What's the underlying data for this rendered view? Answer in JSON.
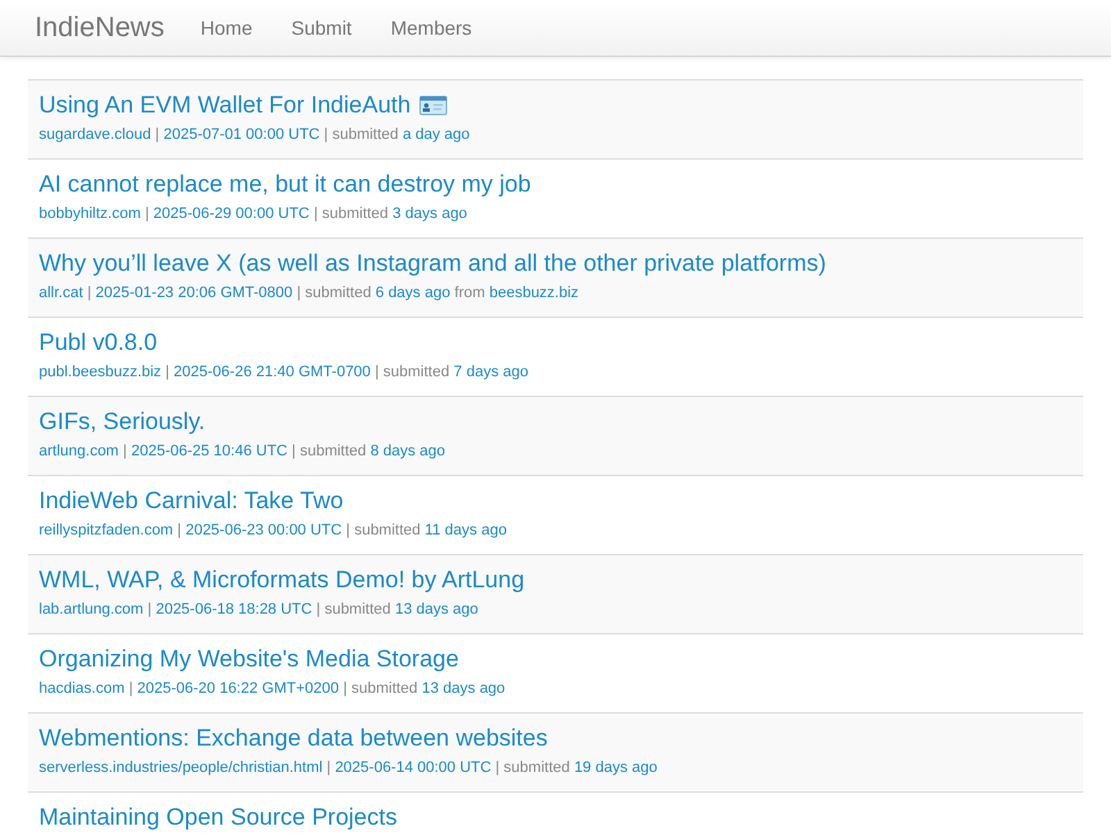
{
  "navbar": {
    "brand": "IndieNews",
    "links": [
      "Home",
      "Submit",
      "Members"
    ]
  },
  "posts": [
    {
      "title": "Using An EVM Wallet For IndieAuth",
      "badge_icon": true,
      "meta": [
        {
          "kind": "link",
          "text": "sugardave.cloud"
        },
        {
          "kind": "plain",
          "text": "|"
        },
        {
          "kind": "link",
          "text": "2025-07-01 00:00 UTC"
        },
        {
          "kind": "plain",
          "text": "| submitted"
        },
        {
          "kind": "link",
          "text": "a day ago"
        }
      ]
    },
    {
      "title": "AI cannot replace me, but it can destroy my job",
      "meta": [
        {
          "kind": "link",
          "text": "bobbyhiltz.com"
        },
        {
          "kind": "plain",
          "text": "|"
        },
        {
          "kind": "link",
          "text": "2025-06-29 00:00 UTC"
        },
        {
          "kind": "plain",
          "text": "| submitted"
        },
        {
          "kind": "link",
          "text": "3 days ago"
        }
      ]
    },
    {
      "title": "Why you’ll leave X (as well as Instagram and all the other private platforms)",
      "meta": [
        {
          "kind": "link",
          "text": "allr.cat"
        },
        {
          "kind": "plain",
          "text": "|"
        },
        {
          "kind": "link",
          "text": "2025-01-23 20:06 GMT-0800"
        },
        {
          "kind": "plain",
          "text": "| submitted"
        },
        {
          "kind": "link",
          "text": "6 days ago"
        },
        {
          "kind": "plain",
          "text": "from"
        },
        {
          "kind": "link",
          "text": "beesbuzz.biz"
        }
      ]
    },
    {
      "title": "Publ v0.8.0",
      "meta": [
        {
          "kind": "link",
          "text": "publ.beesbuzz.biz"
        },
        {
          "kind": "plain",
          "text": "|"
        },
        {
          "kind": "link",
          "text": "2025-06-26 21:40 GMT-0700"
        },
        {
          "kind": "plain",
          "text": "| submitted"
        },
        {
          "kind": "link",
          "text": "7 days ago"
        }
      ]
    },
    {
      "title": "GIFs, Seriously.",
      "meta": [
        {
          "kind": "link",
          "text": "artlung.com"
        },
        {
          "kind": "plain",
          "text": "|"
        },
        {
          "kind": "link",
          "text": "2025-06-25 10:46 UTC"
        },
        {
          "kind": "plain",
          "text": "| submitted"
        },
        {
          "kind": "link",
          "text": "8 days ago"
        }
      ]
    },
    {
      "title": "IndieWeb Carnival: Take Two",
      "meta": [
        {
          "kind": "link",
          "text": "reillyspitzfaden.com"
        },
        {
          "kind": "plain",
          "text": "|"
        },
        {
          "kind": "link",
          "text": "2025-06-23 00:00 UTC"
        },
        {
          "kind": "plain",
          "text": "| submitted"
        },
        {
          "kind": "link",
          "text": "11 days ago"
        }
      ]
    },
    {
      "title": "WML, WAP, & Microformats Demo! by ArtLung",
      "meta": [
        {
          "kind": "link",
          "text": "lab.artlung.com"
        },
        {
          "kind": "plain",
          "text": "|"
        },
        {
          "kind": "link",
          "text": "2025-06-18 18:28 UTC"
        },
        {
          "kind": "plain",
          "text": "| submitted"
        },
        {
          "kind": "link",
          "text": "13 days ago"
        }
      ]
    },
    {
      "title": "Organizing My Website's Media Storage",
      "meta": [
        {
          "kind": "link",
          "text": "hacdias.com"
        },
        {
          "kind": "plain",
          "text": "|"
        },
        {
          "kind": "link",
          "text": "2025-06-20 16:22 GMT+0200"
        },
        {
          "kind": "plain",
          "text": "| submitted"
        },
        {
          "kind": "link",
          "text": "13 days ago"
        }
      ]
    },
    {
      "title": "Webmentions: Exchange data between websites",
      "meta": [
        {
          "kind": "link",
          "text": "serverless.industries/people/christian.html"
        },
        {
          "kind": "plain",
          "text": "|"
        },
        {
          "kind": "link",
          "text": "2025-06-14 00:00 UTC"
        },
        {
          "kind": "plain",
          "text": "| submitted"
        },
        {
          "kind": "link",
          "text": "19 days ago"
        }
      ]
    },
    {
      "title": "Maintaining Open Source Projects"
    }
  ]
}
